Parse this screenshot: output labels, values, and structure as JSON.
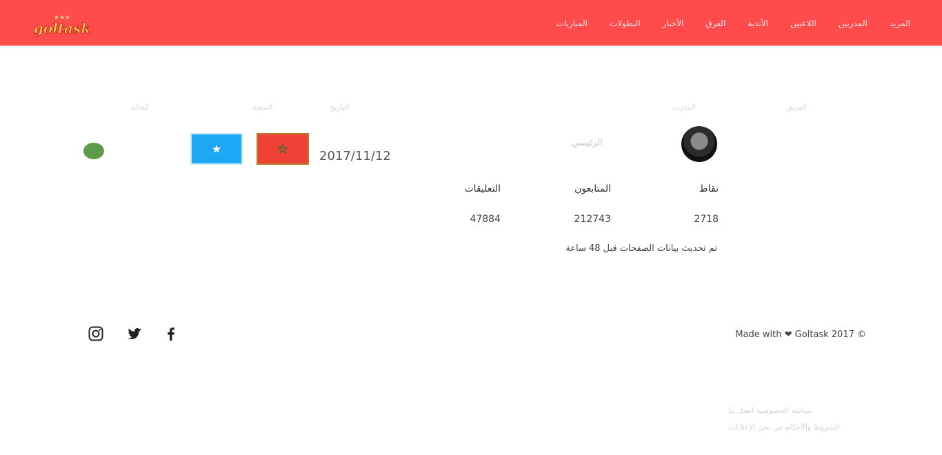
{
  "nav": {
    "logo_alt": "goltask",
    "items": [
      "المزيد",
      "المدربين",
      "اللاعبين",
      "الأندية",
      "الفرق",
      "الأخبار",
      "البطولات",
      "المباريات"
    ]
  },
  "table_headers": {
    "col1": "الحالة",
    "col2": "النتيجة",
    "col3": "التاريخ",
    "col4": "المدرب",
    "col5": "الفريق"
  },
  "match": {
    "date": "2017/11/12",
    "team_name": "الرئيسي",
    "home_flag": "somalia-flag",
    "away_flag": "morocco-flag",
    "status_color": "#5d9a4a"
  },
  "stats": {
    "labels": [
      "نقاط",
      "المتابعون",
      "التعليقات"
    ],
    "values": [
      "2718",
      "212743",
      "47884"
    ]
  },
  "updated_text": "تم تحديث بيانات الصفحات قبل 48 ساعة",
  "footer": {
    "made_with": "Made with ❤ Goltask 2017 ©",
    "social": [
      "instagram-icon",
      "twitter-icon",
      "facebook-icon"
    ],
    "links_line1": "سياسة الخصوصية   اتصل بنا",
    "links_line2": "الشروط والأحكام   من نحن   الإعلانات"
  },
  "colors": {
    "header_bg": "#ff4b4b",
    "accent": "#ff4b4b"
  }
}
